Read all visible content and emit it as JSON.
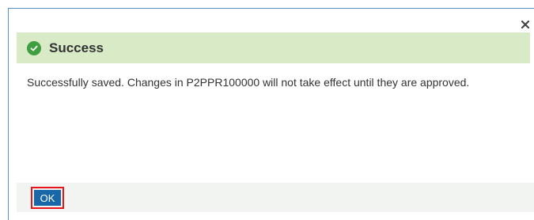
{
  "dialog": {
    "title": "Success",
    "message": "Successfully saved. Changes in P2PPR100000 will not take effect until they are approved.",
    "ok_label": "OK",
    "close_icon": "close-icon",
    "status_icon": "check-circle-icon"
  },
  "colors": {
    "header_bg": "#d9ebc6",
    "success_green": "#3f9e3f",
    "button_blue": "#1767a9",
    "highlight_red": "#e8141b",
    "dialog_border": "#5b8fc4"
  }
}
